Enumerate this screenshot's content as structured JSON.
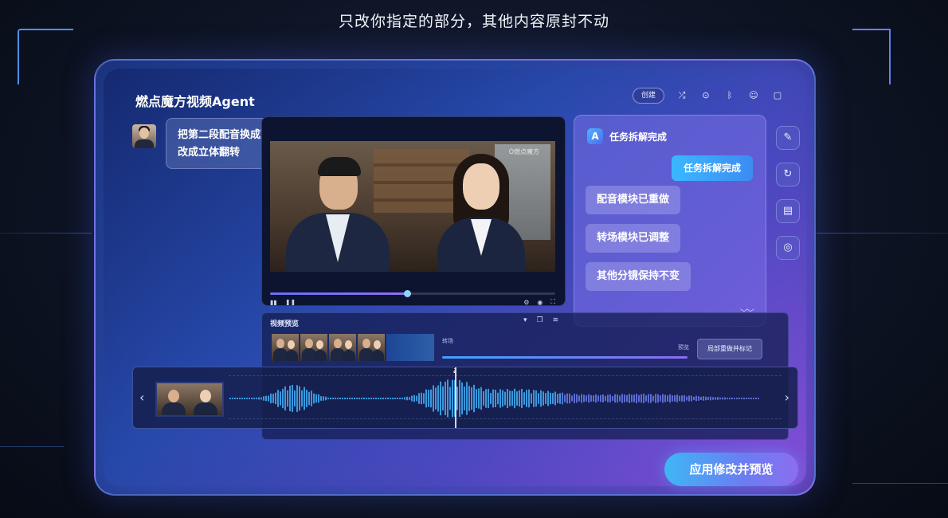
{
  "caption": "只改你指定的部分，其他内容原封不动",
  "app": {
    "title": "燃点魔方视频Agent"
  },
  "toolbar": {
    "pill_label": "创建",
    "icons": [
      "shuffle-icon",
      "location-icon",
      "bluetooth-icon",
      "emoji-icon",
      "phone-icon"
    ]
  },
  "chat": {
    "user_message": "把第二段配音换成更活泼的语气，第三幕转场改成立体翻转"
  },
  "player": {
    "watermark": "Ó燃点魔方",
    "progress": 0.48,
    "controls": [
      "play-icon",
      "pause-icon"
    ]
  },
  "agent": {
    "logo_letter": "A",
    "title": "任务拆解完成",
    "status_bubble": "任务拆解完成",
    "steps": [
      "配音模块已重做",
      "转场模块已调整",
      "其他分镜保持不变"
    ],
    "more": "﹀﹀"
  },
  "side_icons": [
    "edit-icon",
    "refresh-icon",
    "library-icon",
    "shield-icon"
  ],
  "preview": {
    "title": "视频预览",
    "label_a": "转场",
    "label_b": "预览",
    "mark_button": "局部重做并标记"
  },
  "timeline": {
    "left_arrow": "‹",
    "right_arrow": "›",
    "playhead_marker": "⇣"
  },
  "apply_button": "应用修改并预览"
}
